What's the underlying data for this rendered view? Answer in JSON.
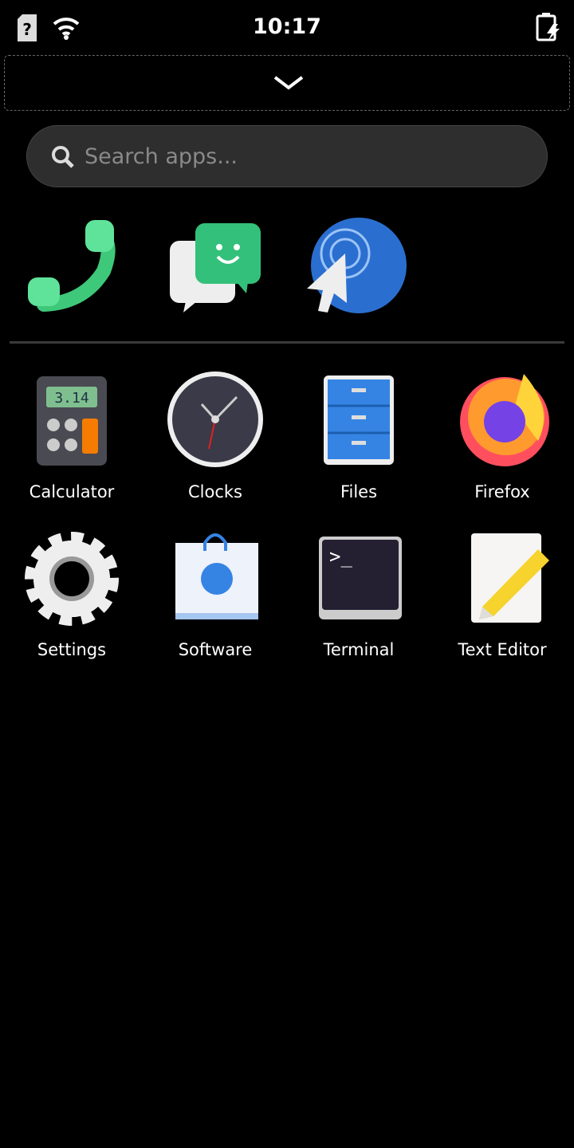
{
  "status": {
    "time": "10:17",
    "icons": [
      "sim-unknown-icon",
      "wifi-icon",
      "battery-charging-icon"
    ]
  },
  "search": {
    "placeholder": "Search apps..."
  },
  "favorites": [
    {
      "name": "phone"
    },
    {
      "name": "chats"
    },
    {
      "name": "web-browser"
    }
  ],
  "apps": [
    {
      "label": "Calculator"
    },
    {
      "label": "Clocks"
    },
    {
      "label": "Files"
    },
    {
      "label": "Firefox"
    },
    {
      "label": "Settings"
    },
    {
      "label": "Software"
    },
    {
      "label": "Terminal"
    },
    {
      "label": "Text Editor"
    }
  ],
  "calculator_display": "3.14"
}
